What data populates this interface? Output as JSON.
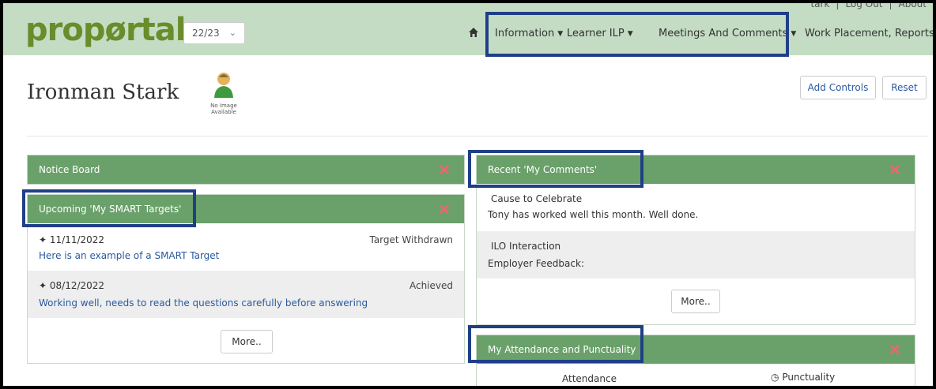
{
  "header": {
    "logo": "propørtal",
    "year_selector": "22/23",
    "top_links": [
      "tark",
      "Log Out",
      "About"
    ],
    "nav": [
      "Information",
      "Learner ILP",
      "Meetings And Comments",
      "Work Placement, Reports"
    ]
  },
  "learner": {
    "name": "Ironman Stark",
    "avatar_caption_1": "No Image",
    "avatar_caption_2": "Available"
  },
  "actions": {
    "add_controls": "Add Controls",
    "reset": "Reset"
  },
  "notice_board": {
    "title": "Notice Board"
  },
  "smart_targets": {
    "title": "Upcoming 'My SMART Targets'",
    "items": [
      {
        "date": "11/11/2022",
        "status": "Target Withdrawn",
        "description": "Here is an example of a SMART Target"
      },
      {
        "date": "08/12/2022",
        "status": "Achieved",
        "description": "Working well, needs to read the questions carefully before answering"
      }
    ],
    "more": "More.."
  },
  "comments": {
    "title": "Recent 'My Comments'",
    "items": [
      {
        "title": "Cause to Celebrate",
        "body": "Tony has worked well this month. Well done."
      },
      {
        "title": "ILO Interaction",
        "body": "Employer Feedback:"
      }
    ],
    "more": "More.."
  },
  "attendance": {
    "title": "My Attendance and Punctuality",
    "col_attendance": "Attendance",
    "col_punctuality": "Punctuality"
  },
  "colors": {
    "header_bg": "#c4dcc4",
    "panel_head": "#6aa16a",
    "highlight": "#1f3f87",
    "close_x": "#e36b6b",
    "link": "#2a5aa0"
  }
}
